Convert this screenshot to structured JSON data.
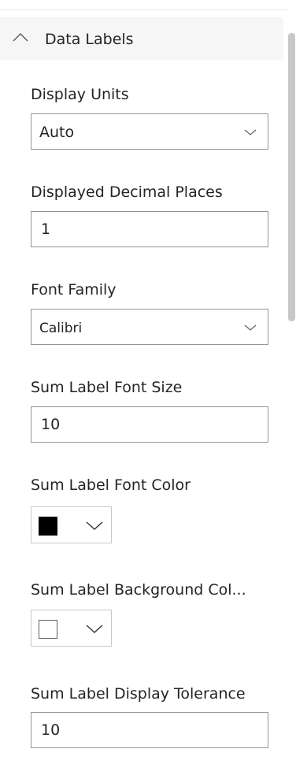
{
  "section": {
    "title": "Data Labels",
    "expanded": true
  },
  "fields": {
    "display_units": {
      "label": "Display Units",
      "value": "Auto"
    },
    "decimal_places": {
      "label": "Displayed Decimal Places",
      "value": "1"
    },
    "font_family": {
      "label": "Font Family",
      "value": "Calibri"
    },
    "sum_font_size": {
      "label": "Sum Label Font Size",
      "value": "10"
    },
    "sum_font_color": {
      "label": "Sum Label Font Color",
      "color": "#000000"
    },
    "sum_bg_color": {
      "label": "Sum Label Background Col...",
      "color": "#ffffff"
    },
    "sum_tolerance": {
      "label": "Sum Label Display Tolerance",
      "value": "10"
    }
  },
  "colors": {
    "header_bg": "#f6f6f6",
    "border": "#949494",
    "scroll_thumb": "#c8c8c8"
  }
}
